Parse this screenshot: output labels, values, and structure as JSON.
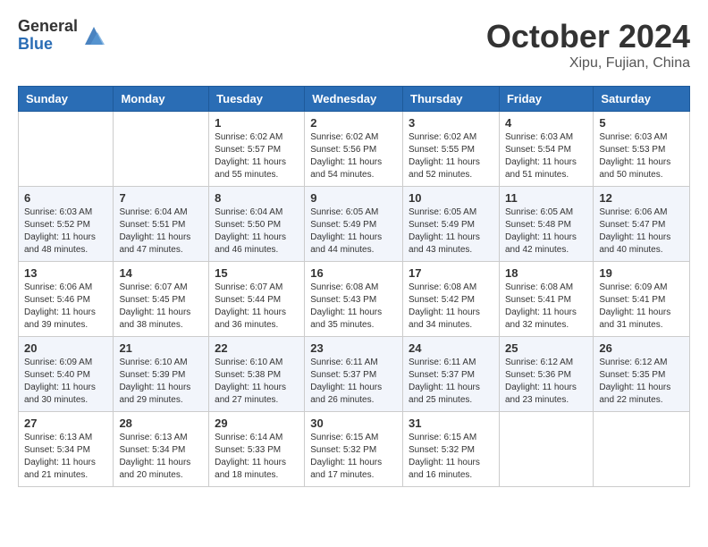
{
  "header": {
    "logo_general": "General",
    "logo_blue": "Blue",
    "month_title": "October 2024",
    "location": "Xipu, Fujian, China"
  },
  "weekdays": [
    "Sunday",
    "Monday",
    "Tuesday",
    "Wednesday",
    "Thursday",
    "Friday",
    "Saturday"
  ],
  "weeks": [
    [
      null,
      null,
      {
        "day": "1",
        "sunrise": "6:02 AM",
        "sunset": "5:57 PM",
        "daylight": "11 hours and 55 minutes."
      },
      {
        "day": "2",
        "sunrise": "6:02 AM",
        "sunset": "5:56 PM",
        "daylight": "11 hours and 54 minutes."
      },
      {
        "day": "3",
        "sunrise": "6:02 AM",
        "sunset": "5:55 PM",
        "daylight": "11 hours and 52 minutes."
      },
      {
        "day": "4",
        "sunrise": "6:03 AM",
        "sunset": "5:54 PM",
        "daylight": "11 hours and 51 minutes."
      },
      {
        "day": "5",
        "sunrise": "6:03 AM",
        "sunset": "5:53 PM",
        "daylight": "11 hours and 50 minutes."
      }
    ],
    [
      {
        "day": "6",
        "sunrise": "6:03 AM",
        "sunset": "5:52 PM",
        "daylight": "11 hours and 48 minutes."
      },
      {
        "day": "7",
        "sunrise": "6:04 AM",
        "sunset": "5:51 PM",
        "daylight": "11 hours and 47 minutes."
      },
      {
        "day": "8",
        "sunrise": "6:04 AM",
        "sunset": "5:50 PM",
        "daylight": "11 hours and 46 minutes."
      },
      {
        "day": "9",
        "sunrise": "6:05 AM",
        "sunset": "5:49 PM",
        "daylight": "11 hours and 44 minutes."
      },
      {
        "day": "10",
        "sunrise": "6:05 AM",
        "sunset": "5:49 PM",
        "daylight": "11 hours and 43 minutes."
      },
      {
        "day": "11",
        "sunrise": "6:05 AM",
        "sunset": "5:48 PM",
        "daylight": "11 hours and 42 minutes."
      },
      {
        "day": "12",
        "sunrise": "6:06 AM",
        "sunset": "5:47 PM",
        "daylight": "11 hours and 40 minutes."
      }
    ],
    [
      {
        "day": "13",
        "sunrise": "6:06 AM",
        "sunset": "5:46 PM",
        "daylight": "11 hours and 39 minutes."
      },
      {
        "day": "14",
        "sunrise": "6:07 AM",
        "sunset": "5:45 PM",
        "daylight": "11 hours and 38 minutes."
      },
      {
        "day": "15",
        "sunrise": "6:07 AM",
        "sunset": "5:44 PM",
        "daylight": "11 hours and 36 minutes."
      },
      {
        "day": "16",
        "sunrise": "6:08 AM",
        "sunset": "5:43 PM",
        "daylight": "11 hours and 35 minutes."
      },
      {
        "day": "17",
        "sunrise": "6:08 AM",
        "sunset": "5:42 PM",
        "daylight": "11 hours and 34 minutes."
      },
      {
        "day": "18",
        "sunrise": "6:08 AM",
        "sunset": "5:41 PM",
        "daylight": "11 hours and 32 minutes."
      },
      {
        "day": "19",
        "sunrise": "6:09 AM",
        "sunset": "5:41 PM",
        "daylight": "11 hours and 31 minutes."
      }
    ],
    [
      {
        "day": "20",
        "sunrise": "6:09 AM",
        "sunset": "5:40 PM",
        "daylight": "11 hours and 30 minutes."
      },
      {
        "day": "21",
        "sunrise": "6:10 AM",
        "sunset": "5:39 PM",
        "daylight": "11 hours and 29 minutes."
      },
      {
        "day": "22",
        "sunrise": "6:10 AM",
        "sunset": "5:38 PM",
        "daylight": "11 hours and 27 minutes."
      },
      {
        "day": "23",
        "sunrise": "6:11 AM",
        "sunset": "5:37 PM",
        "daylight": "11 hours and 26 minutes."
      },
      {
        "day": "24",
        "sunrise": "6:11 AM",
        "sunset": "5:37 PM",
        "daylight": "11 hours and 25 minutes."
      },
      {
        "day": "25",
        "sunrise": "6:12 AM",
        "sunset": "5:36 PM",
        "daylight": "11 hours and 23 minutes."
      },
      {
        "day": "26",
        "sunrise": "6:12 AM",
        "sunset": "5:35 PM",
        "daylight": "11 hours and 22 minutes."
      }
    ],
    [
      {
        "day": "27",
        "sunrise": "6:13 AM",
        "sunset": "5:34 PM",
        "daylight": "11 hours and 21 minutes."
      },
      {
        "day": "28",
        "sunrise": "6:13 AM",
        "sunset": "5:34 PM",
        "daylight": "11 hours and 20 minutes."
      },
      {
        "day": "29",
        "sunrise": "6:14 AM",
        "sunset": "5:33 PM",
        "daylight": "11 hours and 18 minutes."
      },
      {
        "day": "30",
        "sunrise": "6:15 AM",
        "sunset": "5:32 PM",
        "daylight": "11 hours and 17 minutes."
      },
      {
        "day": "31",
        "sunrise": "6:15 AM",
        "sunset": "5:32 PM",
        "daylight": "11 hours and 16 minutes."
      },
      null,
      null
    ]
  ],
  "labels": {
    "sunrise": "Sunrise:",
    "sunset": "Sunset:",
    "daylight": "Daylight:"
  }
}
